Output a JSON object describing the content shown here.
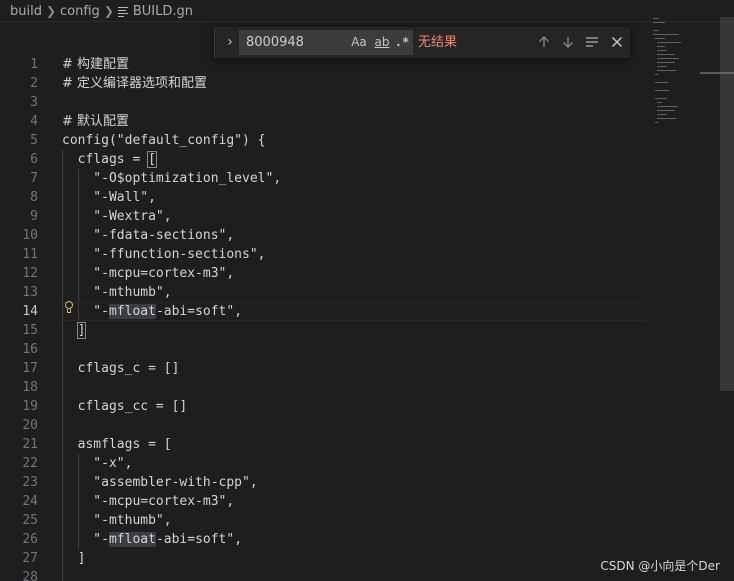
{
  "breadcrumb": {
    "items": [
      "build",
      "config",
      "BUILD.gn"
    ]
  },
  "find_widget": {
    "query": "8000948",
    "match_case_label": "Aa",
    "whole_word_label": "ab",
    "regex_label": ".*",
    "result_text": "无结果",
    "toggle_icon": "chevron-right-icon",
    "prev_icon": "arrow-up-icon",
    "next_icon": "arrow-down-icon",
    "selection_icon": "find-in-selection-icon",
    "close_icon": "close-icon"
  },
  "editor": {
    "active_line": 14,
    "lines": [
      {
        "n": "1",
        "text": "# 构建配置",
        "type": "comment"
      },
      {
        "n": "2",
        "text": "# 定义编译器选项和配置",
        "type": "comment"
      },
      {
        "n": "3",
        "text": "",
        "type": "blank"
      },
      {
        "n": "4",
        "text": "# 默认配置",
        "type": "comment"
      },
      {
        "n": "5",
        "text": "config(\"default_config\") {",
        "type": "code"
      },
      {
        "n": "6",
        "text": "  cflags = [",
        "type": "code"
      },
      {
        "n": "7",
        "text": "    \"-O$optimization_level\",",
        "type": "code"
      },
      {
        "n": "8",
        "text": "    \"-Wall\",",
        "type": "code"
      },
      {
        "n": "9",
        "text": "    \"-Wextra\",",
        "type": "code"
      },
      {
        "n": "10",
        "text": "    \"-fdata-sections\",",
        "type": "code"
      },
      {
        "n": "11",
        "text": "    \"-ffunction-sections\",",
        "type": "code"
      },
      {
        "n": "12",
        "text": "    \"-mcpu=cortex-m3\",",
        "type": "code"
      },
      {
        "n": "13",
        "text": "    \"-mthumb\",",
        "type": "code"
      },
      {
        "n": "14",
        "text": "    \"-mfloat-abi=soft\",",
        "type": "code"
      },
      {
        "n": "15",
        "text": "  ]",
        "type": "code"
      },
      {
        "n": "16",
        "text": "",
        "type": "blank"
      },
      {
        "n": "17",
        "text": "  cflags_c = []",
        "type": "code"
      },
      {
        "n": "18",
        "text": "",
        "type": "blank"
      },
      {
        "n": "19",
        "text": "  cflags_cc = []",
        "type": "code"
      },
      {
        "n": "20",
        "text": "",
        "type": "blank"
      },
      {
        "n": "21",
        "text": "  asmflags = [",
        "type": "code"
      },
      {
        "n": "22",
        "text": "    \"-x\",",
        "type": "code"
      },
      {
        "n": "23",
        "text": "    \"assembler-with-cpp\",",
        "type": "code"
      },
      {
        "n": "24",
        "text": "    \"-mcpu=cortex-m3\",",
        "type": "code"
      },
      {
        "n": "25",
        "text": "    \"-mthumb\",",
        "type": "code"
      },
      {
        "n": "26",
        "text": "    \"-mfloat-abi=soft\",",
        "type": "code"
      },
      {
        "n": "27",
        "text": "  ]",
        "type": "code"
      },
      {
        "n": "28",
        "text": "",
        "type": "blank"
      }
    ],
    "highlight_word": "mfloat",
    "lightbulb_icon": "lightbulb-icon"
  },
  "watermark": "CSDN @小向是个Der",
  "colors": {
    "background": "#1e1e1e",
    "text": "#d4d4d4",
    "line_number": "#6e7681",
    "no_result": "#f48771",
    "find_widget_bg": "#252526",
    "find_input_bg": "#3c3c3c",
    "lightbulb": "#d7ba4a"
  }
}
